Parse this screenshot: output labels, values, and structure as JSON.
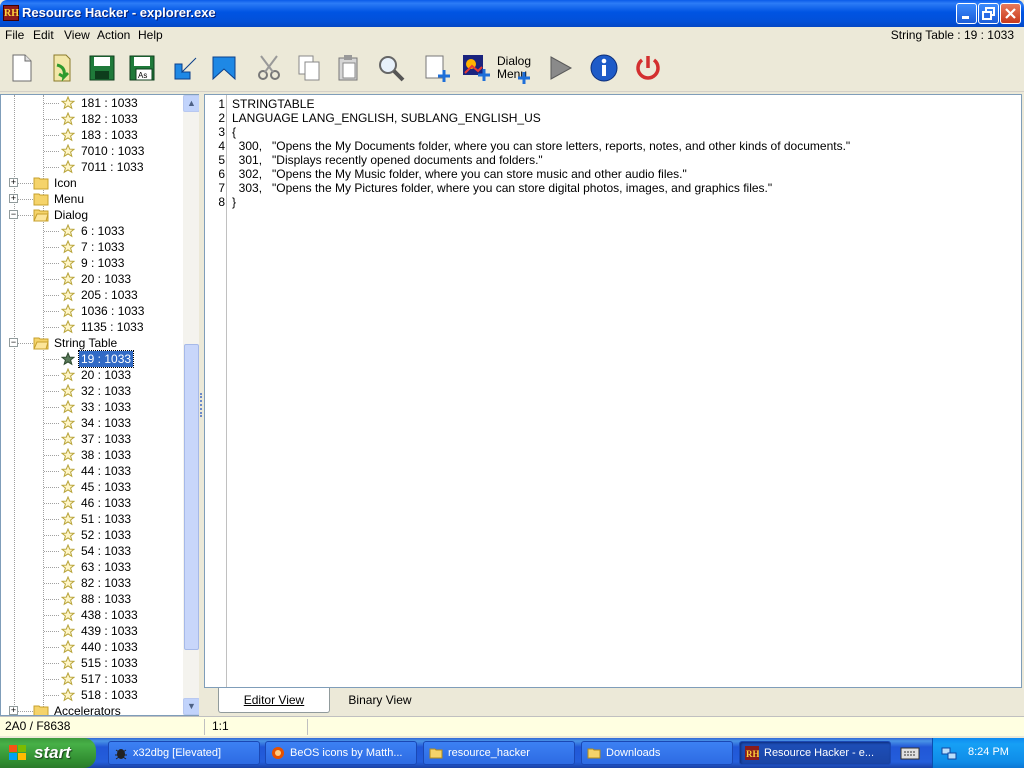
{
  "window": {
    "title": "Resource Hacker - explorer.exe",
    "app_icon_text": "RH"
  },
  "menu": {
    "items": [
      "File",
      "Edit",
      "View",
      "Action",
      "Help"
    ],
    "status": "String Table : 19 : 1033"
  },
  "toolbar": {
    "dialog_menu_label_1": "Dialog",
    "dialog_menu_label_2": "Menu"
  },
  "tree": {
    "top_items": [
      "181 : 1033",
      "182 : 1033",
      "183 : 1033",
      "7010 : 1033",
      "7011 : 1033"
    ],
    "folders": {
      "icon": "Icon",
      "menu": "Menu",
      "dialog": "Dialog",
      "string_table": "String Table",
      "accelerators": "Accelerators"
    },
    "dialog_items": [
      "6 : 1033",
      "7 : 1033",
      "9 : 1033",
      "20 : 1033",
      "205 : 1033",
      "1036 : 1033",
      "1135 : 1033"
    ],
    "string_items": [
      "19 : 1033",
      "20 : 1033",
      "32 : 1033",
      "33 : 1033",
      "34 : 1033",
      "37 : 1033",
      "38 : 1033",
      "44 : 1033",
      "45 : 1033",
      "46 : 1033",
      "51 : 1033",
      "52 : 1033",
      "54 : 1033",
      "63 : 1033",
      "82 : 1033",
      "88 : 1033",
      "438 : 1033",
      "439 : 1033",
      "440 : 1033",
      "515 : 1033",
      "517 : 1033",
      "518 : 1033"
    ],
    "selected": "19 : 1033"
  },
  "editor": {
    "line_numbers": [
      "1",
      "2",
      "3",
      "4",
      "5",
      "6",
      "7",
      "8"
    ],
    "lines": [
      "STRINGTABLE",
      "LANGUAGE LANG_ENGLISH, SUBLANG_ENGLISH_US",
      "{",
      "  300,   \"Opens the My Documents folder, where you can store letters, reports, notes, and other kinds of documents.\"",
      "  301,   \"Displays recently opened documents and folders.\"",
      "  302,   \"Opens the My Music folder, where you can store music and other audio files.\"",
      "  303,   \"Opens the My Pictures folder, where you can store digital photos, images, and graphics files.\"",
      "}"
    ]
  },
  "tabs": {
    "editor": "Editor View",
    "binary": "Binary View",
    "active": "editor"
  },
  "statusbar": {
    "offset": "2A0 / F8638",
    "position": "1:1"
  },
  "taskbar": {
    "start_label": "start",
    "tasks": [
      "x32dbg [Elevated]",
      "BeOS icons by Matth...",
      "resource_hacker",
      "Downloads",
      "Resource Hacker - e..."
    ],
    "active_task": "Resource Hacker - e...",
    "clock": "8:24 PM"
  },
  "colors": {
    "titlebar": "#0054E3",
    "selection": "#316AC5",
    "statusbar_bg": "#FFFFE1",
    "taskbar": "#245EDB",
    "start": "#3C9A3C"
  }
}
